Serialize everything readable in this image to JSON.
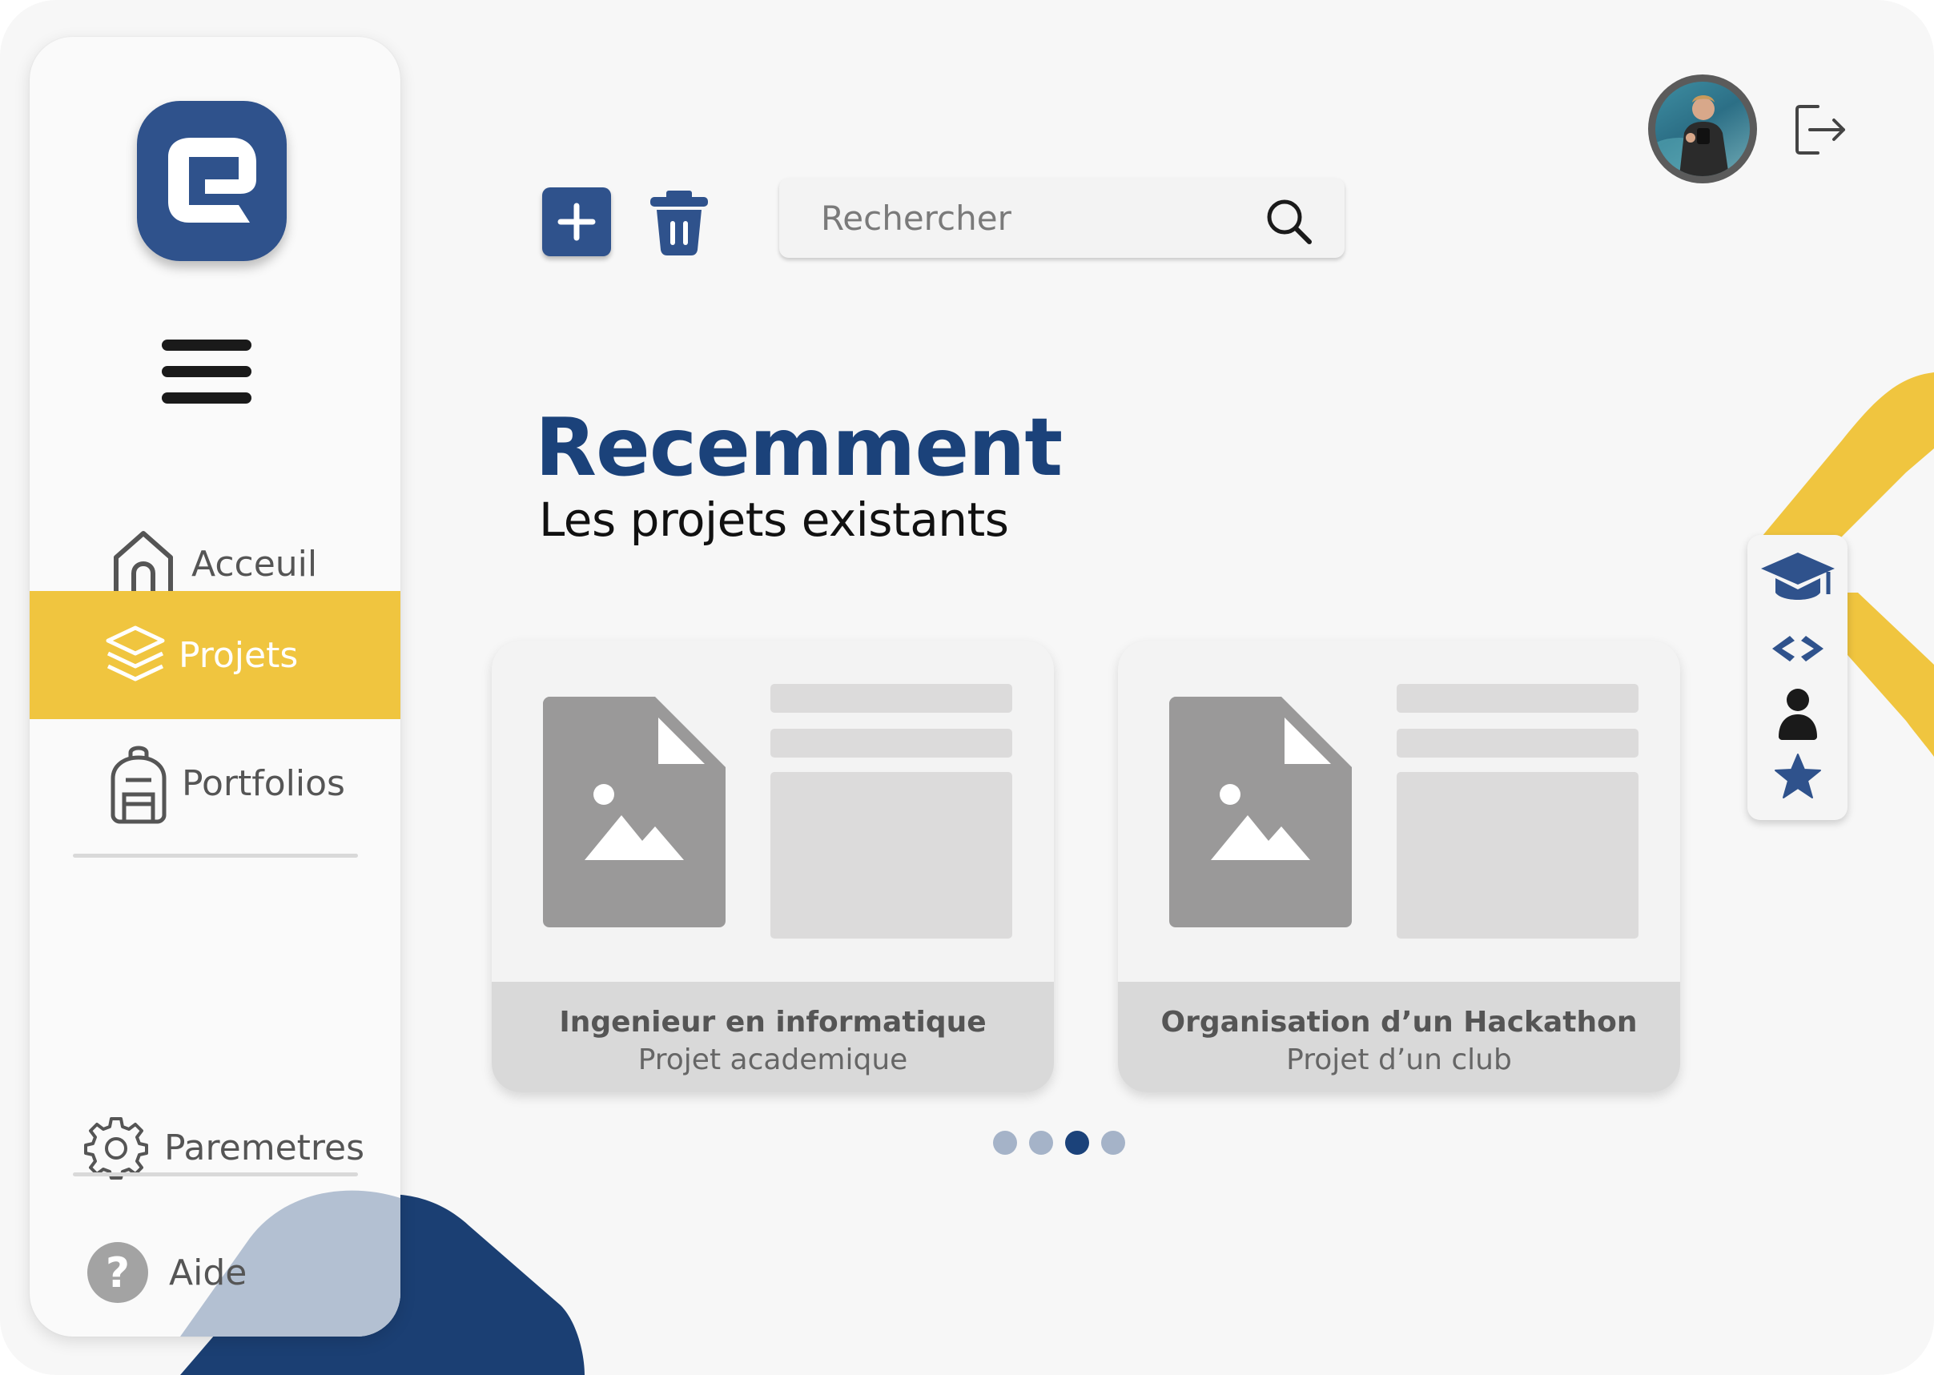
{
  "app": {
    "logo_name": "app-logo"
  },
  "sidebar": {
    "items": [
      {
        "label": "Acceuil",
        "icon": "home-icon",
        "active": false
      },
      {
        "label": "Projets",
        "icon": "layers-icon",
        "active": true
      },
      {
        "label": "Portfolios",
        "icon": "backpack-icon",
        "active": false
      }
    ],
    "bottom_items": [
      {
        "label": "Paremetres",
        "icon": "gear-icon"
      },
      {
        "label": "Aide",
        "icon": "help-icon"
      }
    ]
  },
  "toolbar": {
    "add_icon": "plus-icon",
    "delete_icon": "trash-icon"
  },
  "search": {
    "placeholder": "Rechercher",
    "value": "",
    "icon": "search-icon"
  },
  "header": {
    "avatar": "user-avatar",
    "logout_icon": "logout-icon"
  },
  "main": {
    "title": "Recemment",
    "subtitle": "Les projets existants",
    "cards": [
      {
        "title": "Ingenieur en informatique",
        "subtitle": "Projet academique"
      },
      {
        "title": "Organisation d’un Hackathon",
        "subtitle": "Projet d’un club"
      }
    ],
    "pagination": {
      "total": 4,
      "current": 3
    }
  },
  "side_tools": [
    "graduation-cap-icon",
    "code-icon",
    "user-icon",
    "star-icon"
  ],
  "colors": {
    "primary": "#2f528c",
    "primary_dark": "#1b427a",
    "accent": "#f0c53f",
    "background": "#f7f7f7",
    "card_gray": "#d9d9d9",
    "thumb_gray": "#9a9999"
  }
}
